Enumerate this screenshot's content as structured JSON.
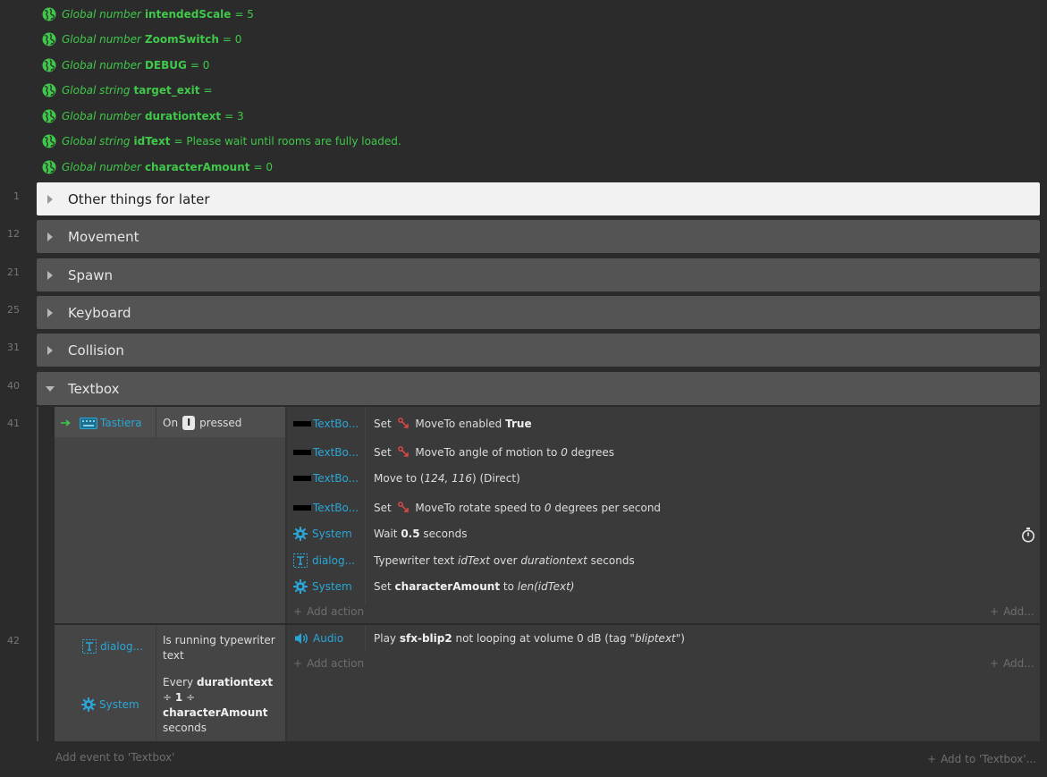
{
  "globals": [
    {
      "kind": "Global number",
      "name": "intendedScale",
      "value": "= 5"
    },
    {
      "kind": "Global number",
      "name": "ZoomSwitch",
      "value": "= 0"
    },
    {
      "kind": "Global number",
      "name": "DEBUG",
      "value": "= 0"
    },
    {
      "kind": "Global string",
      "name": "target_exit",
      "value": "="
    },
    {
      "kind": "Global number",
      "name": "durationtext",
      "value": "= 3"
    },
    {
      "kind": "Global string",
      "name": "idText",
      "value": "= Please wait until rooms are fully loaded."
    },
    {
      "kind": "Global number",
      "name": "characterAmount",
      "value": "= 0"
    }
  ],
  "groups": [
    {
      "line": "1",
      "title": "Other things for later"
    },
    {
      "line": "12",
      "title": "Movement"
    },
    {
      "line": "21",
      "title": "Spawn"
    },
    {
      "line": "25",
      "title": "Keyboard"
    },
    {
      "line": "31",
      "title": "Collision"
    },
    {
      "line": "40",
      "title": "Textbox"
    }
  ],
  "event41": {
    "line": "41",
    "object": "Tastiera",
    "cond_prefix": "On",
    "key": "I",
    "cond_suffix": "pressed",
    "actions": [
      {
        "object": "TextBo...",
        "text_pre": "Set",
        "text_rest": "MoveTo enabled",
        "bold": "True",
        "tail": ""
      },
      {
        "object": "TextBo...",
        "text_pre": "Set",
        "text_rest": "MoveTo angle of motion to",
        "italic": "0",
        "tail": "degrees"
      },
      {
        "object": "TextBo...",
        "text": "Move to (",
        "italic": "124, 116",
        "tail": ") (Direct)"
      },
      {
        "object": "TextBo...",
        "text_pre": "Set",
        "text_rest": "MoveTo rotate speed to",
        "italic": "0",
        "tail": "degrees per second"
      },
      {
        "object": "System",
        "text": "Wait",
        "bold": "0.5",
        "tail": "seconds"
      },
      {
        "object": "dialog...",
        "text": "Typewriter text",
        "italic": "idText",
        "mid": "over",
        "italic2": "durationtext",
        "tail": "seconds"
      },
      {
        "object": "System",
        "text": "Set",
        "bold": "characterAmount",
        "mid": "to",
        "italic": "len(idText)"
      }
    ],
    "add_action": "Add action",
    "add_more": "Add..."
  },
  "event42": {
    "line": "42",
    "cond1_object": "dialog...",
    "cond1_text": "Is running typewriter text",
    "cond2_object": "System",
    "cond2_every": "Every",
    "cond2_bold1": "durationtext",
    "cond2_op1": "÷",
    "cond2_bold2": "1",
    "cond2_op2": "÷",
    "cond2_bold3": "characterAmount",
    "cond2_tail": "seconds",
    "action_object": "Audio",
    "action_play": "Play",
    "action_bold": "sfx-blip2",
    "action_mid": "not looping at volume 0 dB (tag \"",
    "action_italic": "bliptext",
    "action_end": "\")",
    "add_action": "Add action",
    "add_more": "Add..."
  },
  "footer": {
    "add_event": "Add event to 'Textbox'",
    "add_to": "Add to 'Textbox'..."
  },
  "colors": {
    "green": "#3fc84a",
    "blue": "#2aa6d6",
    "bg": "#2b2b2b"
  }
}
